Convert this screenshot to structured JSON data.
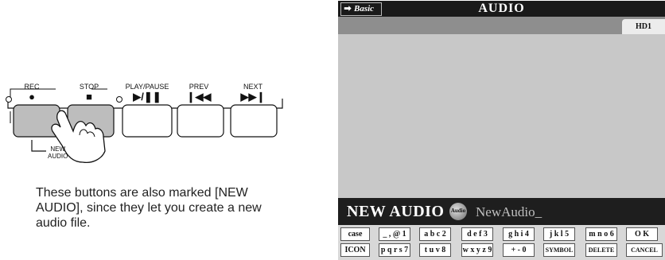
{
  "buttons": [
    {
      "label": "REC",
      "symbol": "●"
    },
    {
      "label": "STOP",
      "symbol": "■"
    },
    {
      "label": "PLAY/PAUSE",
      "symbol": "▶/❚❚"
    },
    {
      "label": "PREV",
      "symbol": "❙◀◀"
    },
    {
      "label": "NEXT",
      "symbol": "▶▶❙"
    }
  ],
  "new_audio_mark": [
    "NEW",
    "AUDIO"
  ],
  "caption": "These buttons are also marked [NEW AUDIO], since they let you create a new audio file.",
  "screen": {
    "mode_label": "Basic",
    "mode_arrow": "➡",
    "title": "AUDIO",
    "drive_tab": "HD1",
    "name_title": "NEW AUDIO",
    "icon_text": "Audio",
    "name_value": "NewAudio_",
    "keys_row1": [
      "case",
      "_ , @ 1",
      "a b c 2",
      "d e f 3",
      "g h i 4",
      "j k l 5",
      "m n o 6",
      "O K"
    ],
    "keys_row2": [
      "ICON",
      "p q r s 7",
      "t u v 8",
      "w x y z 9",
      "+ - 0",
      "SYMBOL",
      "DELETE",
      "CANCEL"
    ]
  }
}
